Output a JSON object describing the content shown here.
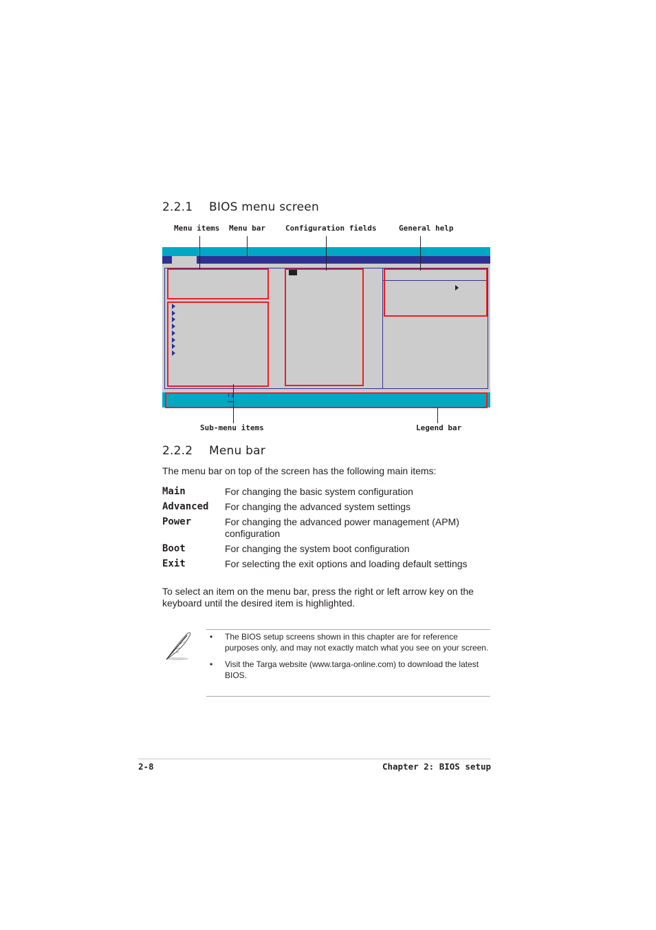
{
  "section_1": {
    "number": "2.2.1",
    "title": "BIOS menu screen",
    "callouts": {
      "menu_items": "Menu items",
      "menu_bar": "Menu bar",
      "configuration_fields": "Configuration fields",
      "general_help": "General help",
      "sub_menu_items": "Sub-menu items",
      "legend_bar": "Legend bar"
    },
    "bios_figure": {
      "submenu_arrow_count": 8,
      "legend_keys": [
        "↑↓",
        "→←"
      ],
      "colors": {
        "title_bar": "#00a8c4",
        "menu_bar": "#2e3192",
        "body": "#cccccc",
        "highlight_box": "#ed1c24",
        "legend_bar": "#00a8c4"
      }
    }
  },
  "section_2": {
    "number": "2.2.2",
    "title": "Menu bar",
    "intro": "The menu bar on top of the screen has the following main items:",
    "items": [
      {
        "term": "Main",
        "description": "For changing the basic system configuration"
      },
      {
        "term": "Advanced",
        "description": "For changing the advanced system settings"
      },
      {
        "term": "Power",
        "description": "For changing the advanced power management (APM) configuration"
      },
      {
        "term": "Boot",
        "description": "For changing the system boot configuration"
      },
      {
        "term": "Exit",
        "description": "For selecting the exit options and loading default settings"
      }
    ],
    "instruction": "To select an item on the menu bar, press the right or left arrow key on the keyboard until the desired item is highlighted."
  },
  "note": {
    "icon": "feather-quill-icon",
    "bullets": [
      "The BIOS setup screens shown in this chapter are for reference purposes only, and may not exactly match what you see on your screen.",
      "Visit the Targa website (www.targa-online.com) to download the latest BIOS."
    ]
  },
  "footer": {
    "page_number": "2-8",
    "chapter": "Chapter 2: BIOS setup"
  }
}
